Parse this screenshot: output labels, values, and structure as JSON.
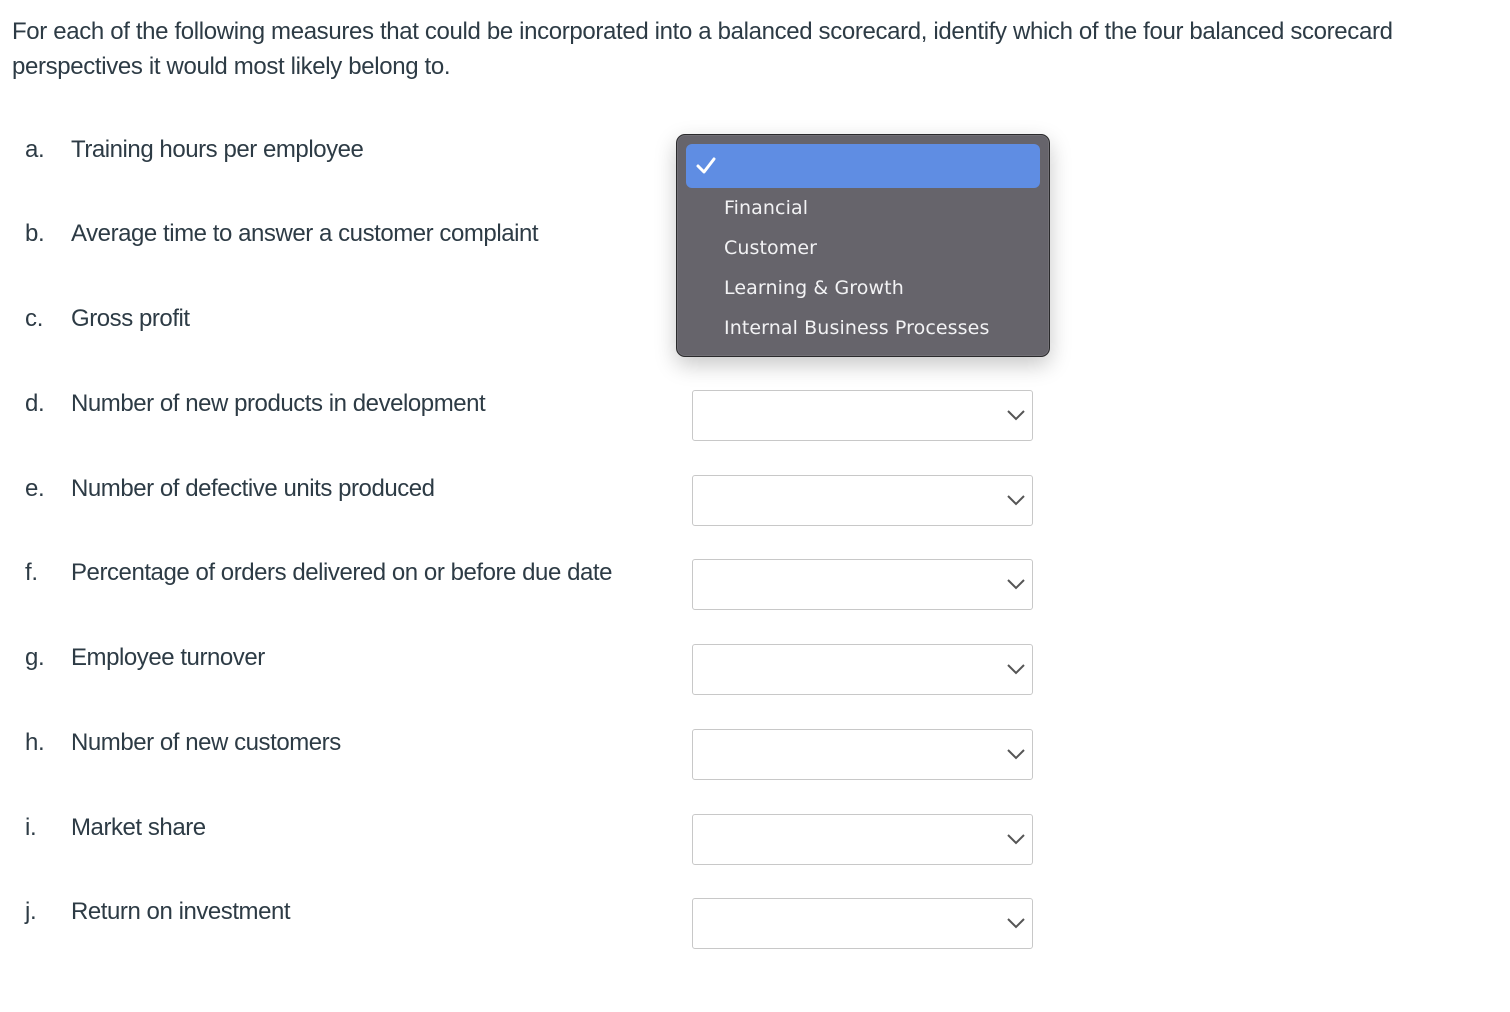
{
  "prompt": "For each of the following measures that could be incorporated into a balanced scorecard, identify which of the four balanced scorecard perspectives it would most likely belong to.",
  "questions": [
    {
      "letter": "a.",
      "text": "Training hours per employee",
      "selected": ""
    },
    {
      "letter": "b.",
      "text": "Average time to answer a customer complaint",
      "selected": ""
    },
    {
      "letter": "c.",
      "text": "Gross profit",
      "selected": ""
    },
    {
      "letter": "d.",
      "text": "Number of new products in development",
      "selected": ""
    },
    {
      "letter": "e.",
      "text": "Number of defective units produced",
      "selected": ""
    },
    {
      "letter": "f.",
      "text": "Percentage of orders delivered on or before due date",
      "selected": ""
    },
    {
      "letter": "g.",
      "text": "Employee turnover",
      "selected": ""
    },
    {
      "letter": "h.",
      "text": "Number of new customers",
      "selected": ""
    },
    {
      "letter": "i.",
      "text": "Market share",
      "selected": ""
    },
    {
      "letter": "j.",
      "text": "Return on investment",
      "selected": ""
    }
  ],
  "dropdown_menu": {
    "open_for_question": "a.",
    "icons": {
      "selected_marker": "checkmark-icon",
      "select_arrow": "chevron-down-icon"
    },
    "options": [
      {
        "label": "",
        "checked": true
      },
      {
        "label": "Financial",
        "checked": false
      },
      {
        "label": "Customer",
        "checked": false
      },
      {
        "label": "Learning & Growth",
        "checked": false
      },
      {
        "label": "Internal Business Processes",
        "checked": false
      }
    ]
  },
  "colors": {
    "text": "#2d3b45",
    "menu_background": "#66646b",
    "menu_highlight": "#5f8de3",
    "menu_text": "#f2f2f4",
    "select_border": "#c8c8c8"
  }
}
